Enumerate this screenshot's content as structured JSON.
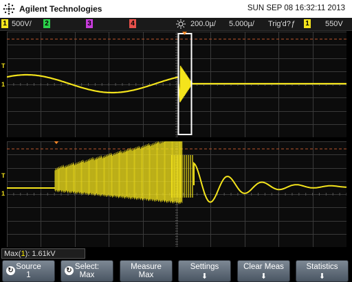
{
  "header": {
    "brand": "Agilent Technologies",
    "datetime": "SUN SEP 08 16:32:11 2013"
  },
  "status": {
    "ch1_num": "1",
    "ch1_scale": "500V/",
    "ch2_num": "2",
    "ch3_num": "3",
    "ch4_num": "4",
    "timebase": "200.0µ/",
    "delay": "5.000µ/",
    "trig_status": "Trig'd?",
    "trig_slope": "ƒ",
    "trig_ch": "1",
    "trig_level": "550V",
    "colors": {
      "ch1": "#f4e41c",
      "ch2": "#2bd14a",
      "ch3": "#c83cdc",
      "ch4": "#e8514b"
    }
  },
  "markers": {
    "trigger_level": "T",
    "ground_ch1": "1"
  },
  "readout": {
    "prefix": "Max(",
    "channel": "1",
    "suffix": "): 1.61kV"
  },
  "softkeys": {
    "source_line1": "Source",
    "source_line2": "1",
    "select_line1": "Select:",
    "select_line2": "Max",
    "measure_line1": "Measure",
    "measure_line2": "Max",
    "settings": "Settings",
    "clear_meas": "Clear Meas",
    "statistics": "Statistics",
    "down_arrow": "⬇"
  }
}
